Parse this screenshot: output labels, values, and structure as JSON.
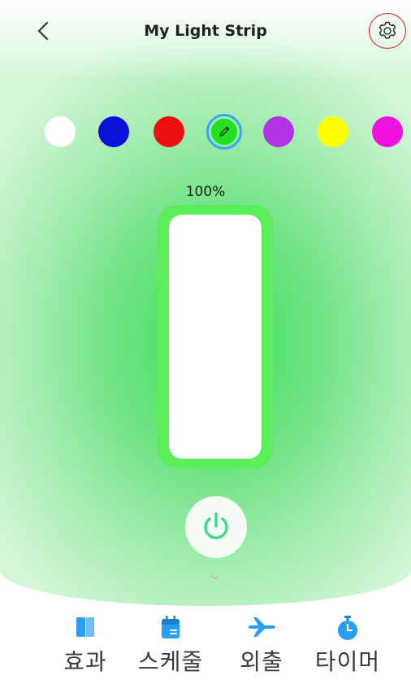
{
  "header": {
    "title": "My Light Strip",
    "back_icon": "chevron-left-icon",
    "settings_icon": "gear-icon"
  },
  "colors": {
    "swatches": [
      "#ffffff",
      "#0a10d8",
      "#ee0f0f",
      "#22e022",
      "#b332e6",
      "#ffff00",
      "#ee11dd"
    ],
    "selected": "#22e022",
    "selected_ring": "#37a7f4",
    "selected_icon": "pencil-icon"
  },
  "brightness": {
    "label": "100%",
    "value": 1.0
  },
  "power": {
    "icon": "power-icon",
    "state": "on"
  },
  "nav": {
    "items": [
      {
        "label": "효과",
        "icon": "effects-icon"
      },
      {
        "label": "스케줄",
        "icon": "calendar-icon"
      },
      {
        "label": "외출",
        "icon": "airplane-icon"
      },
      {
        "label": "타이머",
        "icon": "timer-icon"
      }
    ],
    "icon_color": "#2a9df4"
  }
}
